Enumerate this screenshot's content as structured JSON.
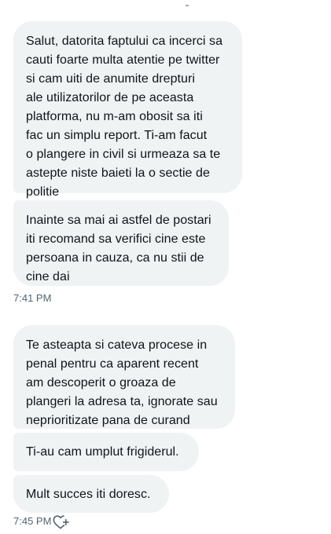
{
  "messages": [
    {
      "text": "Salut, datorita faptului ca incerci sa\ncauti foarte multa atentie pe twitter\nsi cam uiti de anumite drepturi\nale utilizatorilor de pe aceasta\nplatforma, nu m-am obosit sa iti\nfac un simplu report. Ti-am facut\no plangere in civil si urmeaza sa te\nastepte niste baieti la o sectie de\npolitie"
    },
    {
      "text": "Inainte sa mai ai astfel de postari\niti recomand sa verifici cine este\npersoana in cauza, ca nu stii de\ncine dai"
    },
    {
      "text": "Te asteapta si cateva procese in\npenal pentru ca aparent recent\nam descoperit o groaza de\nplangeri la adresa ta, ignorate sau\nneprioritizate pana de curand"
    },
    {
      "text": "Ti-au cam umplut frigiderul."
    },
    {
      "text": "Mult succes iti doresc."
    }
  ],
  "timestamps": {
    "first": "7:41 PM",
    "second": "7:45 PM"
  },
  "icons": {
    "react": "add-reaction-icon"
  },
  "colors": {
    "bubble_bg": "#eff3f4",
    "text": "#0f1419",
    "timestamp": "#536471"
  }
}
